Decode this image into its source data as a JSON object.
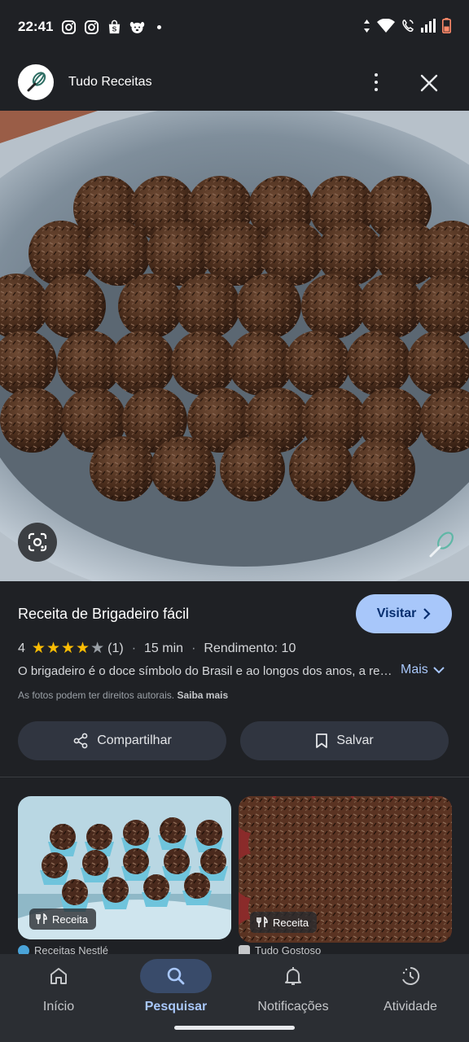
{
  "status_bar": {
    "time": "22:41",
    "left_icons": [
      "instagram-icon",
      "instagram-icon",
      "shopee-icon",
      "pet-app-icon"
    ],
    "right_icons": [
      "data-arrows-icon",
      "wifi-icon",
      "wifi-calling-icon",
      "signal-icon",
      "battery-low-icon"
    ]
  },
  "header": {
    "site_name": "Tudo Receitas",
    "logo_icon": "whisk-icon",
    "menu_icon": "more-vert-icon",
    "close_icon": "close-icon"
  },
  "hero": {
    "image_subject": "brigadeiros on a silver tray",
    "lens_icon": "google-lens-icon",
    "watermark_icon": "whisk-icon"
  },
  "recipe": {
    "title": "Receita de Brigadeiro fácil",
    "visit_label": "Visitar",
    "rating": "4",
    "rating_value": 4,
    "rating_max": 5,
    "rating_count": "(1)",
    "time": "15 min",
    "yield": "Rendimento: 10",
    "description": "O brigadeiro é o doce símbolo do Brasil e ao longos dos anos, a receita de brigadeiro ganhou muitas versões",
    "more_label": "Mais",
    "copyright_text": "As fotos podem ter direitos autorais.",
    "copyright_link": "Saiba mais",
    "share_label": "Compartilhar",
    "save_label": "Salvar"
  },
  "related": [
    {
      "badge": "Receita",
      "source": "Receitas Nestlé"
    },
    {
      "badge": "Receita",
      "source": "Tudo Gostoso"
    }
  ],
  "nav": [
    {
      "label": "Início",
      "icon": "home-icon",
      "active": false
    },
    {
      "label": "Pesquisar",
      "icon": "search-icon",
      "active": true
    },
    {
      "label": "Notificações",
      "icon": "bell-icon",
      "active": false
    },
    {
      "label": "Atividade",
      "icon": "activity-icon",
      "active": false
    }
  ],
  "colors": {
    "background": "#1f2125",
    "accent": "#a8c7fa",
    "star": "#fbbc04",
    "button_bg": "#303540",
    "nav_active_pill": "#394b6a"
  }
}
